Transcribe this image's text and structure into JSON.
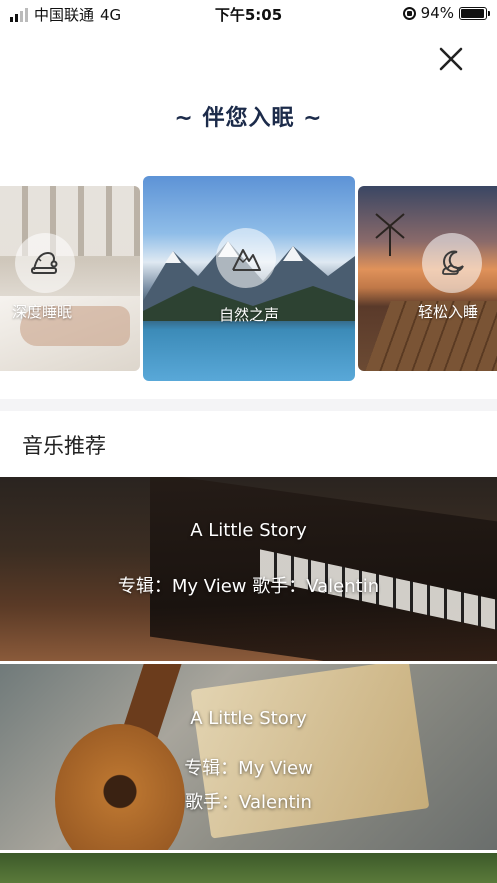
{
  "status_bar": {
    "carrier": "中国联通",
    "network": "4G",
    "time": "下午5:05",
    "battery_percent_text": "94%",
    "battery_level": 0.94
  },
  "header": {
    "title": "~ 伴您入眠 ~",
    "close_icon": "close-icon"
  },
  "categories": [
    {
      "label": "深度睡眠",
      "icon": "sleep-cap-icon"
    },
    {
      "label": "自然之声",
      "icon": "mountain-icon"
    },
    {
      "label": "轻松入睡",
      "icon": "moon-cloud-icon"
    }
  ],
  "section": {
    "title": "音乐推荐"
  },
  "music": [
    {
      "title": "A Little Story",
      "info": "专辑：My View 歌手：Valentin"
    },
    {
      "title": "A Little Story",
      "album": "专辑：My View",
      "singer": "歌手：Valentin"
    }
  ],
  "colors": {
    "title": "#1c2b4a",
    "divider": "#f4f4f6"
  }
}
